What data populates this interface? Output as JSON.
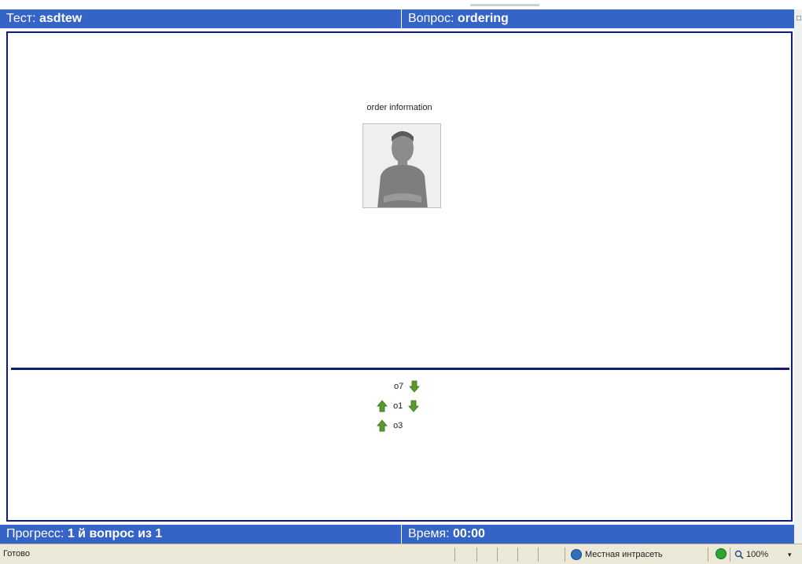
{
  "header": {
    "test_label": "Тест: ",
    "test_name": "asdtew",
    "question_label": "Вопрос: ",
    "question_name": "ordering"
  },
  "question": {
    "title": "order information",
    "image_icon": "person-photo"
  },
  "answers": [
    {
      "label": "o7",
      "up": false,
      "down": true
    },
    {
      "label": "o1",
      "up": true,
      "down": true
    },
    {
      "label": "o3",
      "up": true,
      "down": false
    }
  ],
  "footer": {
    "progress_label": "Прогресс: ",
    "progress_value": "1 й вопрос из 1",
    "time_label": "Время: ",
    "time_value": "00:00"
  },
  "statusbar": {
    "status": "Готово",
    "zone": "Местная интрасеть",
    "zoom": "100%"
  },
  "colors": {
    "bar": "#3564c6",
    "border": "#101c6e",
    "arrow_green": "#5a9a2a"
  }
}
